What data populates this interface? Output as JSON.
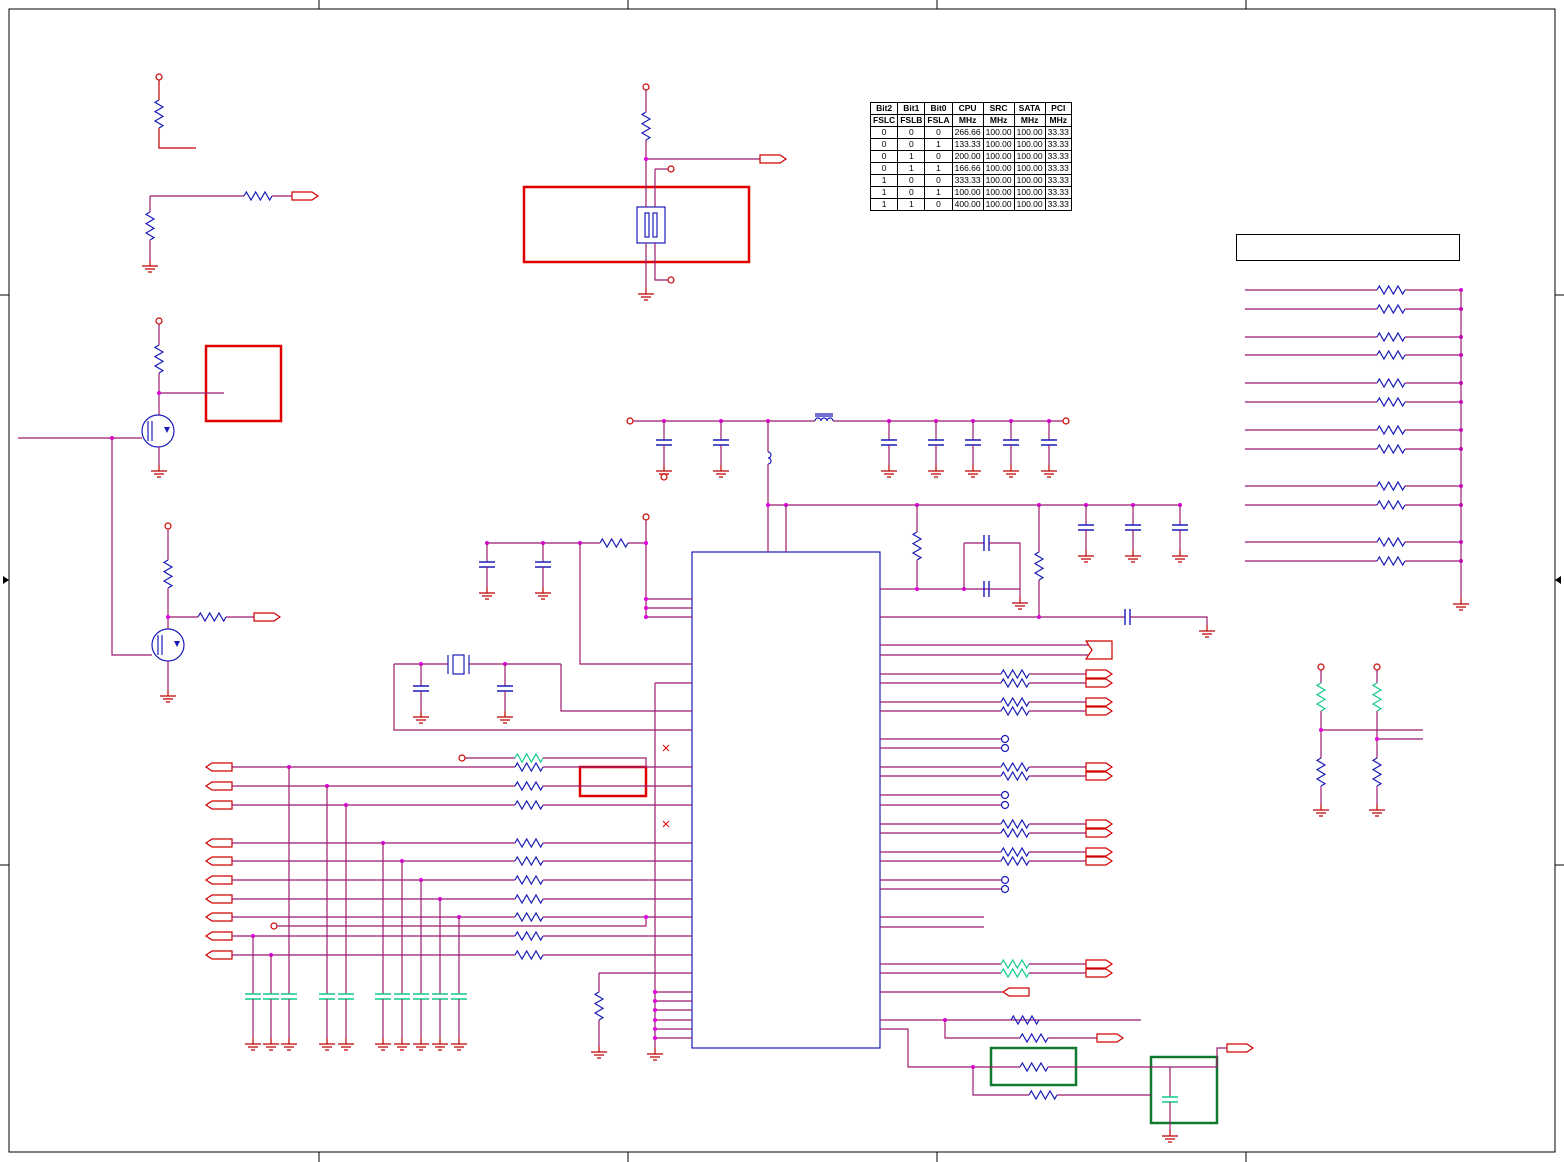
{
  "freq_table": {
    "header1": [
      "Bit2",
      "Bit1",
      "Bit0",
      "CPU",
      "SRC",
      "SATA",
      "PCI"
    ],
    "header2": [
      "FSLC",
      "FSLB",
      "FSLA",
      "MHz",
      "MHz",
      "MHz",
      "MHz"
    ],
    "rows": [
      [
        "0",
        "0",
        "0",
        "266.66",
        "100.00",
        "100.00",
        "33.33"
      ],
      [
        "0",
        "0",
        "1",
        "133.33",
        "100.00",
        "100.00",
        "33.33"
      ],
      [
        "0",
        "1",
        "0",
        "200.00",
        "100.00",
        "100.00",
        "33.33"
      ],
      [
        "0",
        "1",
        "1",
        "166.66",
        "100.00",
        "100.00",
        "33.33"
      ],
      [
        "1",
        "0",
        "0",
        "333.33",
        "100.00",
        "100.00",
        "33.33"
      ],
      [
        "1",
        "0",
        "1",
        "100.00",
        "100.00",
        "100.00",
        "33.33"
      ],
      [
        "1",
        "1",
        "0",
        "400.00",
        "100.00",
        "100.00",
        "33.33"
      ]
    ]
  },
  "colors": {
    "wire": "#9b1b6e",
    "power_ground": "#c00000",
    "resistor": "#1a1ab8",
    "resistor_alt": "#11c98a",
    "junction": "#e000e0",
    "highlight_red": "#e00000",
    "highlight_green": "#117a2e",
    "ic_outline": "#1a1ab8"
  }
}
